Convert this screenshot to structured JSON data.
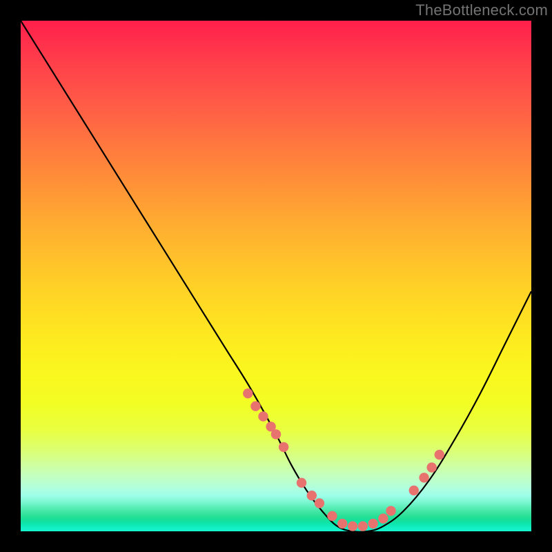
{
  "watermark": "TheBottleneck.com",
  "colors": {
    "background": "#000000",
    "watermark": "#737373",
    "curve_stroke": "#000000",
    "marker_fill": "#e8726e",
    "gradient_top": "#ff1f4b",
    "gradient_mid": "#ffdd23",
    "gradient_bottom": "#18f4d0"
  },
  "chart_data": {
    "type": "line",
    "title": "",
    "xlabel": "",
    "ylabel": "",
    "xlim": [
      0,
      100
    ],
    "ylim": [
      0,
      100
    ],
    "grid": false,
    "series": [
      {
        "name": "bottleneck-curve",
        "x": [
          0,
          5,
          10,
          15,
          20,
          25,
          30,
          35,
          40,
          45,
          50,
          53,
          56,
          59,
          62,
          65,
          68,
          71,
          75,
          80,
          85,
          90,
          95,
          100
        ],
        "y": [
          100,
          92,
          84,
          76,
          68,
          60,
          52,
          44,
          36,
          28,
          19,
          13,
          8,
          4,
          1,
          0,
          0,
          1,
          4,
          10,
          18,
          27,
          37,
          47
        ]
      }
    ],
    "markers": {
      "name": "scatter-points",
      "x": [
        44.5,
        46,
        47.5,
        49,
        50,
        51.5,
        55,
        57,
        58.5,
        61,
        63,
        65,
        67,
        69,
        71,
        72.5,
        77,
        79,
        80.5,
        82
      ],
      "y": [
        27,
        24.5,
        22.5,
        20.5,
        19,
        16.5,
        9.5,
        7,
        5.5,
        3,
        1.5,
        1,
        1,
        1.5,
        2.5,
        4,
        8,
        10.5,
        12.5,
        15
      ]
    }
  }
}
